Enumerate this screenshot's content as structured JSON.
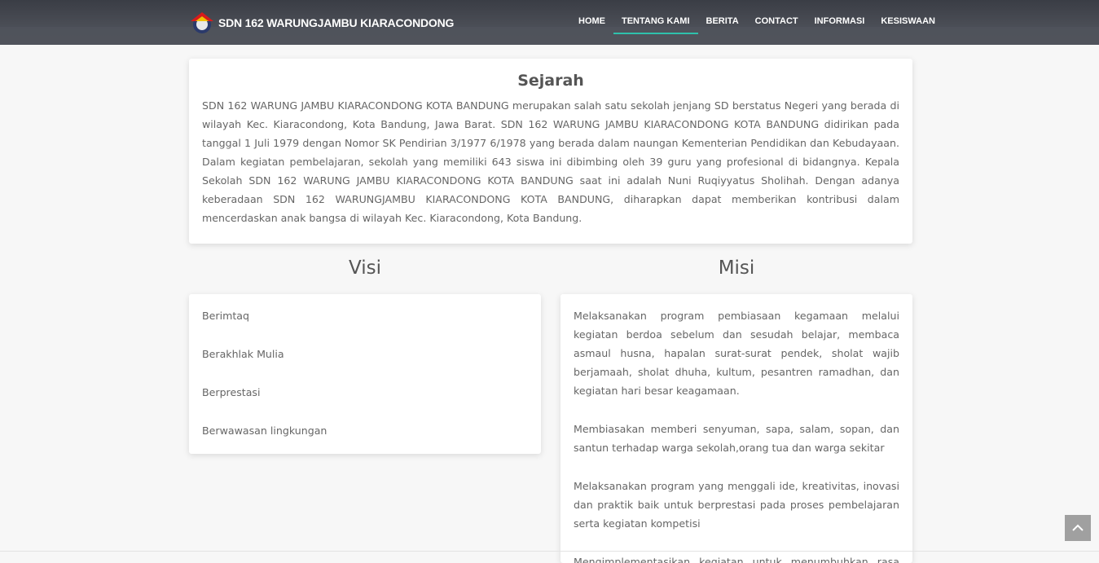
{
  "header": {
    "brand": "SDN 162 WARUNGJAMBU KIARACONDONG",
    "nav": [
      {
        "label": "HOME",
        "active": false
      },
      {
        "label": "TENTANG KAMI",
        "active": true
      },
      {
        "label": "BERITA",
        "active": false
      },
      {
        "label": "CONTACT",
        "active": false
      },
      {
        "label": "INFORMASI",
        "active": false
      },
      {
        "label": "KESISWAAN",
        "active": false
      }
    ],
    "active_color": "#2ec1ac"
  },
  "sejarah": {
    "title": "Sejarah",
    "text": "SDN 162 WARUNG JAMBU KIARACONDONG KOTA BANDUNG merupakan salah satu sekolah jenjang SD berstatus Negeri yang berada di wilayah Kec. Kiaracondong, Kota Bandung, Jawa Barat. SDN 162 WARUNG JAMBU KIARACONDONG KOTA BANDUNG didirikan pada tanggal 1 Juli 1979 dengan Nomor SK Pendirian 3/1977 6/1978 yang berada dalam naungan Kementerian Pendidikan dan Kebudayaan. Dalam kegiatan pembelajaran, sekolah yang memiliki 643 siswa ini dibimbing oleh 39 guru yang profesional di bidangnya. Kepala Sekolah SDN 162 WARUNG JAMBU KIARACONDONG KOTA BANDUNG saat ini adalah Nuni Ruqiyyatus Sholihah. Dengan adanya keberadaan SDN 162 WARUNGJAMBU KIARACONDONG KOTA BANDUNG, diharapkan dapat memberikan kontribusi dalam mencerdaskan anak bangsa di wilayah Kec. Kiaracondong, Kota Bandung."
  },
  "visi": {
    "title": "Visi",
    "items": [
      "Berimtaq",
      "Berakhlak Mulia",
      "Berprestasi",
      "Berwawasan lingkungan"
    ]
  },
  "misi": {
    "title": "Misi",
    "items": [
      "Melaksanakan program pembiasaan kegamaan melalui kegiatan berdoa sebelum dan sesudah belajar, membaca asmaul husna, hapalan surat-surat pendek, sholat wajib berjamaah, sholat dhuha, kultum, pesantren ramadhan, dan kegiatan hari besar keagamaan.",
      "Membiasakan memberi senyuman, sapa, salam, sopan, dan santun terhadap warga sekolah,orang tua dan warga sekitar",
      "Melaksanakan program yang menggali ide, kreativitas, inovasi dan praktik baik untuk berprestasi pada proses pembelajaran serta kegiatan kompetisi",
      "Mengimplementasikan kegiatan untuk menumbuhkan rasa cinta"
    ]
  },
  "scroll_top_icon": "chevron-up-icon"
}
